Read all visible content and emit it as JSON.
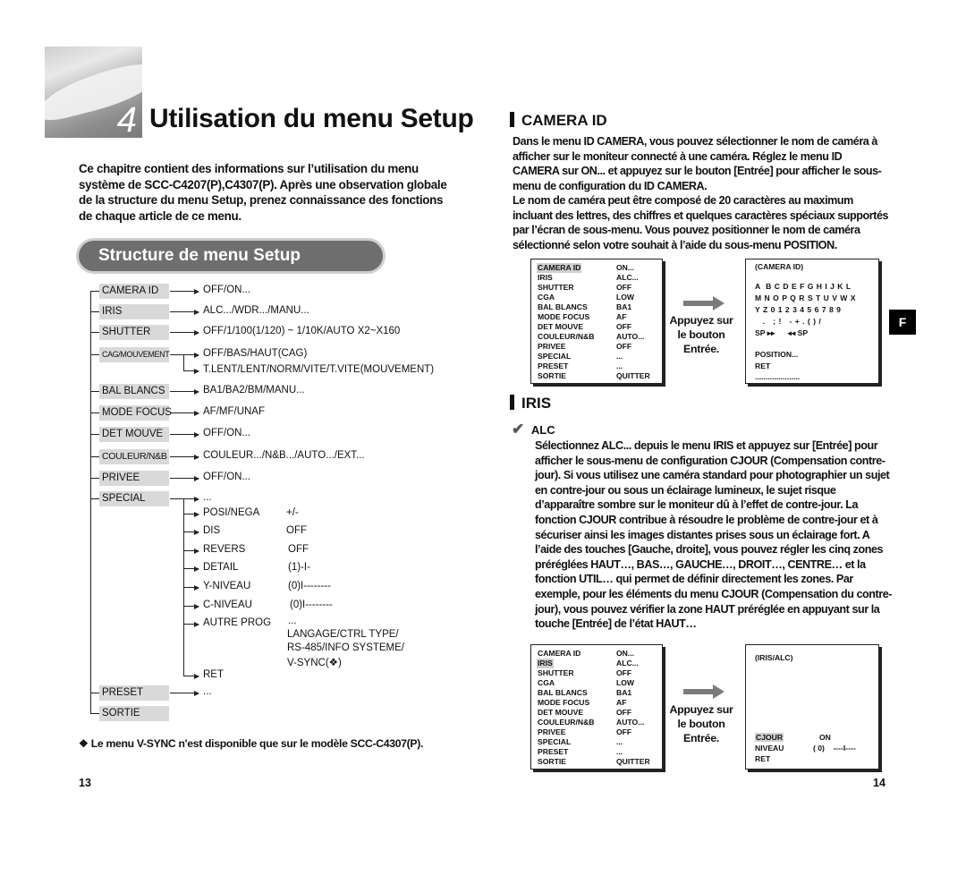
{
  "left_page": {
    "chapter_number": "4",
    "chapter_title": "Utilisation du menu Setup",
    "intro": "Ce chapitre contient des informations sur l’utilisation du menu système de SCC-C4207(P),C4307(P). Après une observation globale de la structure du menu Setup, prenez connaissance des fonctions de chaque article de ce menu.",
    "section_pill": "Structure de menu Setup",
    "tree": {
      "camera_id": {
        "label": "CAMERA ID",
        "value": "OFF/ON..."
      },
      "iris": {
        "label": "IRIS",
        "value": "ALC.../WDR.../MANU..."
      },
      "shutter": {
        "label": "SHUTTER",
        "value": "OFF/1/100(1/120) ~ 1/10K/AUTO X2~X160"
      },
      "cag": {
        "label": "CAG/MOUVEMENT",
        "value1": "OFF/BAS/HAUT(CAG)",
        "value2": "T.LENT/LENT/NORM/VITE/T.VITE(MOUVEMENT)"
      },
      "bal_blancs": {
        "label": "BAL BLANCS",
        "value": "BA1/BA2/BM/MANU..."
      },
      "mode_focus": {
        "label": "MODE FOCUS",
        "value": "AF/MF/UNAF"
      },
      "det_mouve": {
        "label": "DET MOUVE",
        "value": "OFF/ON..."
      },
      "couleur": {
        "label": "COULEUR/N&B",
        "value": "COULEUR.../N&B.../AUTO.../EXT..."
      },
      "privee": {
        "label": "PRIVEE",
        "value": "OFF/ON..."
      },
      "special": {
        "label": "SPECIAL",
        "value": "...",
        "sub": [
          {
            "label": "POSI/NEGA",
            "value": "+/-"
          },
          {
            "label": "DIS",
            "value": "OFF"
          },
          {
            "label": "REVERS",
            "value": "OFF"
          },
          {
            "label": "DETAIL",
            "value": "(1)-I-"
          },
          {
            "label": "Y-NIVEAU",
            "value": "(0)I--------"
          },
          {
            "label": "C-NIVEAU",
            "value": "(0)I--------"
          },
          {
            "label": "AUTRE PROG",
            "value": "...",
            "detail": [
              "LANGAGE/CTRL TYPE/",
              "RS-485/INFO SYSTEME/",
              "V-SYNC(❖)"
            ]
          },
          {
            "label": "RET",
            "value": ""
          }
        ]
      },
      "preset": {
        "label": "PRESET",
        "value": "..."
      },
      "sortie": {
        "label": "SORTIE"
      }
    },
    "note_symbol": "❖",
    "note": "Le menu V-SYNC n'est disponible que sur le modèle SCC-C4307(P).",
    "page_number": "13"
  },
  "right_page": {
    "camera_id": {
      "heading": "CAMERA ID",
      "paragraph1": "Dans le menu ID CAMERA, vous pouvez sélectionner le nom de caméra à afficher sur le moniteur connecté à une caméra. Réglez le menu ID CAMERA sur ON... et appuyez sur le bouton [Entrée] pour afficher le sous-menu de configuration du ID CAMERA.",
      "paragraph2": "Le nom de caméra peut être composé de 20 caractères au maximum incluant des lettres, des chiffres et quelques caractères spéciaux supportés par l’écran de sous-menu. Vous pouvez positionner le nom de caméra sélectionné selon votre souhait à l’aide du sous-menu POSITION.",
      "menu": [
        {
          "key": "CAMERA ID",
          "value": "ON...",
          "highlight": true
        },
        {
          "key": "IRIS",
          "value": "ALC..."
        },
        {
          "key": "SHUTTER",
          "value": "OFF"
        },
        {
          "key": "CGA",
          "value": "LOW"
        },
        {
          "key": "BAL BLANCS",
          "value": "BA1"
        },
        {
          "key": "MODE FOCUS",
          "value": "AF"
        },
        {
          "key": "DET MOUVE",
          "value": "OFF"
        },
        {
          "key": "COULEUR/N&B",
          "value": "AUTO..."
        },
        {
          "key": "PRIVEE",
          "value": "OFF"
        },
        {
          "key": "SPECIAL",
          "value": "..."
        },
        {
          "key": "PRESET",
          "value": "..."
        },
        {
          "key": "SORTIE",
          "value": "QUITTER"
        }
      ],
      "press_label": [
        "Appuyez sur",
        "le bouton",
        "Entrée."
      ],
      "submenu": {
        "title": "(CAMERA ID)",
        "chars": [
          "A  B C D E F G H I J K L",
          "M N O P Q R S T U V W X",
          "Y Z 0 1 2 3 4 5 6 7 8 9",
          "   .   ; !   - + . ( ) /",
          "SP ▸▸      ◂◂ SP"
        ],
        "position": "POSITION...",
        "ret": "RET",
        "name_field": "....................."
      }
    },
    "iris": {
      "heading": "IRIS",
      "subheading": "ALC",
      "paragraph": "Sélectionnez ALC... depuis le menu IRIS et appuyez sur [Entrée] pour afficher le sous-menu de configuration CJOUR (Compensation contre-jour). Si vous utilisez une caméra standard pour photographier un sujet en contre-jour ou sous un éclairage lumineux, le sujet risque d’apparaître sombre sur le moniteur dû à l’effet de contre-jour. La fonction CJOUR contribue à résoudre le problème de contre-jour et à sécuriser ainsi les images distantes prises sous un éclairage fort. A l’aide des touches [Gauche, droite], vous pouvez régler les cinq zones préréglées HAUT…, BAS…, GAUCHE…, DROIT…, CENTRE… et la fonction UTIL… qui permet de définir directement les zones. Par exemple, pour les éléments du menu CJOUR (Compensation du contre-jour), vous pouvez vérifier la zone HAUT préréglée en appuyant sur la touche [Entrée] de l’état HAUT…",
      "menu": [
        {
          "key": "CAMERA ID",
          "value": "ON..."
        },
        {
          "key": "IRIS",
          "value": "ALC...",
          "highlight": true
        },
        {
          "key": "SHUTTER",
          "value": "OFF"
        },
        {
          "key": "CGA",
          "value": "LOW"
        },
        {
          "key": "BAL BLANCS",
          "value": "BA1"
        },
        {
          "key": "MODE FOCUS",
          "value": "AF"
        },
        {
          "key": "DET MOUVE",
          "value": "OFF"
        },
        {
          "key": "COULEUR/N&B",
          "value": "AUTO..."
        },
        {
          "key": "PRIVEE",
          "value": "OFF"
        },
        {
          "key": "SPECIAL",
          "value": "..."
        },
        {
          "key": "PRESET",
          "value": "..."
        },
        {
          "key": "SORTIE",
          "value": "QUITTER"
        }
      ],
      "press_label": [
        "Appuyez sur",
        "le bouton",
        "Entrée."
      ],
      "submenu": {
        "title": "(IRIS/ALC)",
        "cjour": {
          "key": "CJOUR",
          "value": "ON"
        },
        "niveau": {
          "key": "NIVEAU",
          "value": "( 0)    ----I----"
        },
        "ret": "RET"
      }
    },
    "side_tab": "F",
    "page_number": "14"
  }
}
